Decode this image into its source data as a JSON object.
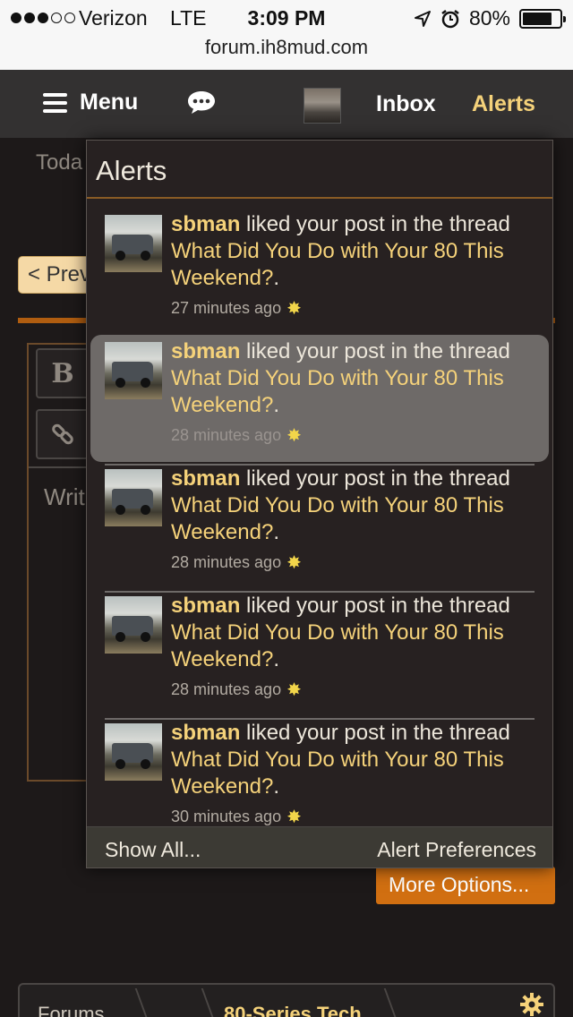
{
  "status_bar": {
    "carrier": "Verizon",
    "network": "LTE",
    "time": "3:09 PM",
    "battery": "80%",
    "battery_level": 0.8,
    "signal_bars_filled": 3,
    "signal_bars_total": 5,
    "icons": [
      "location-arrow-icon",
      "alarm-clock-icon",
      "battery-icon"
    ]
  },
  "browser": {
    "url": "forum.ih8mud.com"
  },
  "nav": {
    "menu_label": "Menu",
    "inbox_label": "Inbox",
    "alerts_label": "Alerts",
    "colors": {
      "bar": "#333131",
      "alerts_accent": "#f5d27a"
    }
  },
  "background_page": {
    "today_text": "Toda",
    "prev_button": "< Prev",
    "bold_button": "B",
    "write_placeholder": "Writ",
    "more_options_button": "More Options...",
    "breadcrumbs": [
      "Forums",
      "80-Series Tech"
    ],
    "colors": {
      "more_options": "#d16f11",
      "prev_button": "#f5d9a6"
    }
  },
  "alerts_popup": {
    "title": "Alerts",
    "items": [
      {
        "user": "sbman",
        "action": " liked your post in the thread ",
        "thread": "What Did You Do with Your 80 This Weekend?",
        "suffix": ".",
        "time": "27 minutes ago",
        "highlighted": false
      },
      {
        "user": "sbman",
        "action": " liked your post in the thread ",
        "thread": "What Did You Do with Your 80 This Weekend?",
        "suffix": ".",
        "time": "28 minutes ago",
        "highlighted": true
      },
      {
        "user": "sbman",
        "action": " liked your post in the thread ",
        "thread": "What Did You Do with Your 80 This Weekend?",
        "suffix": ".",
        "time": "28 minutes ago",
        "highlighted": false
      },
      {
        "user": "sbman",
        "action": " liked your post in the thread ",
        "thread": "What Did You Do with Your 80 This Weekend?",
        "suffix": ".",
        "time": "28 minutes ago",
        "highlighted": false
      },
      {
        "user": "sbman",
        "action": " liked your post in the thread ",
        "thread": "What Did You Do with Your 80 This Weekend?",
        "suffix": ".",
        "time": "30 minutes ago",
        "highlighted": false
      }
    ],
    "footer": {
      "show_all": "Show All...",
      "preferences": "Alert Preferences"
    },
    "colors": {
      "link": "#f5d27a",
      "highlight": "#6e6a68",
      "panel": "#272121"
    }
  }
}
